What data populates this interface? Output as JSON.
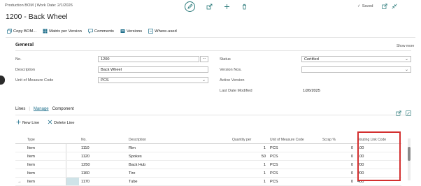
{
  "breadcrumb": "Production BOM | Work Date: 2/1/2026",
  "page_title": "1200 - Back Wheel",
  "status_saved": "Saved",
  "actions": [
    "Copy BOM...",
    "Matrix per Version",
    "Comments",
    "Versions",
    "Where-used"
  ],
  "general": {
    "heading": "General",
    "show_more": "Show more",
    "no_label": "No.",
    "no_value": "1200",
    "description_label": "Description",
    "description_value": "Back Wheel",
    "uom_label": "Unit of Measure Code",
    "uom_value": "PCS",
    "status_label": "Status",
    "status_value": "Certified",
    "version_nos_label": "Version Nos.",
    "version_nos_value": "",
    "active_version_label": "Active Version",
    "active_version_value": "",
    "last_modified_label": "Last Date Modified",
    "last_modified_value": "1/26/2025"
  },
  "lines": {
    "tab_lines": "Lines",
    "tab_manage": "Manage",
    "tab_component": "Component",
    "new_line": "New Line",
    "delete_line": "Delete Line",
    "columns": [
      "Type",
      "No.",
      "Description",
      "Quantity per",
      "Unit of Measure Code",
      "Scrap %",
      "Routing Link Code"
    ],
    "rows": [
      {
        "type": "Item",
        "no": "1110",
        "desc": "Rim",
        "qty": "1",
        "uom": "PCS",
        "scrap": "0",
        "routing": "100"
      },
      {
        "type": "Item",
        "no": "1120",
        "desc": "Spokes",
        "qty": "50",
        "uom": "PCS",
        "scrap": "0",
        "routing": "100"
      },
      {
        "type": "Item",
        "no": "1250",
        "desc": "Back Hub",
        "qty": "1",
        "uom": "PCS",
        "scrap": "0",
        "routing": "200"
      },
      {
        "type": "Item",
        "no": "1160",
        "desc": "Tire",
        "qty": "1",
        "uom": "PCS",
        "scrap": "0",
        "routing": "200"
      },
      {
        "type": "Item",
        "no": "1170",
        "desc": "Tube",
        "qty": "1",
        "uom": "PCS",
        "scrap": "0",
        "routing": "400"
      }
    ]
  },
  "colors": {
    "accent": "#1f6f8b",
    "highlight_box": "#d32f2f",
    "selected_cell": "#cfe3e8"
  }
}
